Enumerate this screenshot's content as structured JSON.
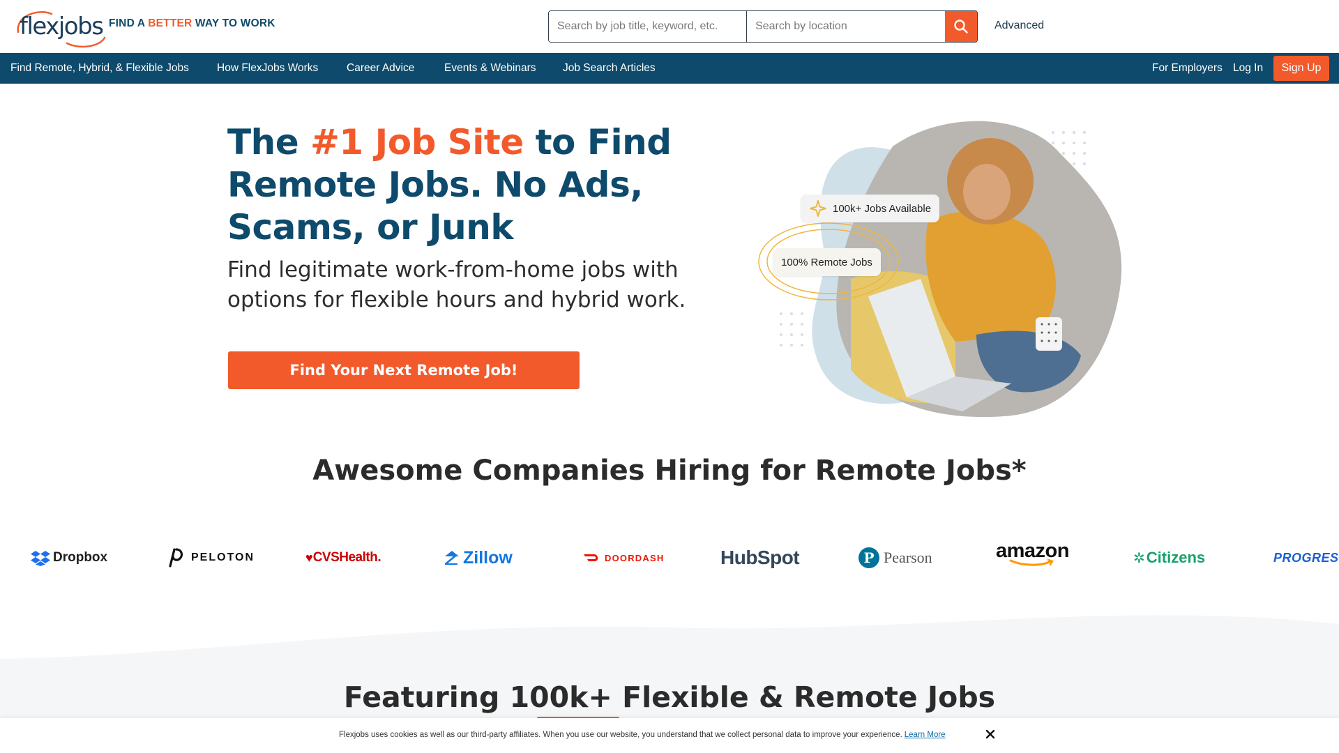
{
  "brand": {
    "logo_text": "flexjobs",
    "tagline_prefix": "FIND A ",
    "tagline_accent": "BETTER",
    "tagline_suffix": " WAY TO WORK",
    "accent_color": "#f25a2b",
    "primary_color": "#0e4a6b"
  },
  "search": {
    "keyword_placeholder": "Search by job title, keyword, etc.",
    "location_placeholder": "Search by location",
    "button_icon": "search-icon",
    "advanced_label": "Advanced"
  },
  "nav": {
    "items": [
      "Find Remote, Hybrid, & Flexible Jobs",
      "How FlexJobs Works",
      "Career Advice",
      "Events & Webinars",
      "Job Search Articles"
    ],
    "employers": "For Employers",
    "login": "Log In",
    "signup": "Sign Up"
  },
  "hero": {
    "title_1": "The ",
    "title_accent": "#1 Job Site",
    "title_2": " to Find Remote Jobs. No Ads, Scams, or Junk",
    "subtitle": "Find legitimate work-from-home jobs with options for flexible hours and hybrid work.",
    "cta": "Find Your Next Remote Job!",
    "badge_jobs": "100k+ Jobs Available",
    "badge_remote": "100% Remote Jobs"
  },
  "companies": {
    "title": "Awesome Companies Hiring for Remote Jobs*",
    "logos": [
      "Dropbox",
      "PELOTON",
      "CVSHealth.",
      "Zillow",
      "DOORDASH",
      "HubSpot",
      "Pearson",
      "amazon",
      "Citizens",
      "PROGRESSIVE"
    ]
  },
  "featuring": {
    "prefix": "Featuring ",
    "accent": "100k+",
    "suffix": " Flexible & Remote Jobs"
  },
  "cookie": {
    "text": "Flexjobs uses cookies as well as our third-party affiliates. When you use our website, you understand that we collect personal data to improve your experience.",
    "link": "Learn More",
    "close_icon": "close-icon"
  }
}
